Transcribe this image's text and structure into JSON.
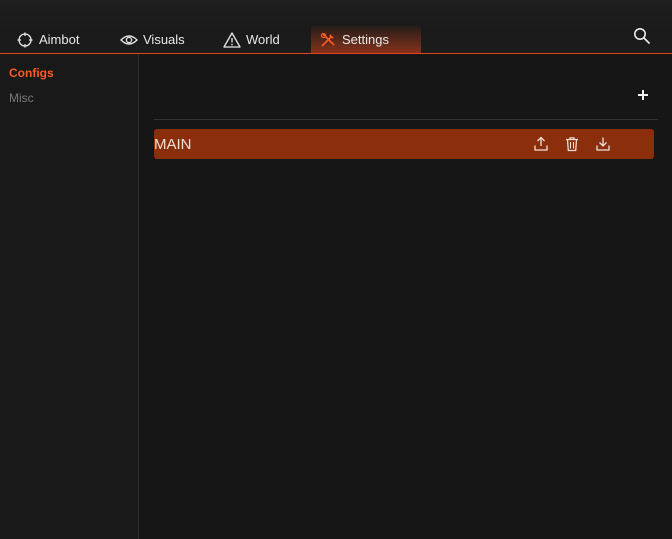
{
  "nav": {
    "tabs": [
      {
        "label": "Aimbot",
        "icon": "crosshair-icon",
        "active": false
      },
      {
        "label": "Visuals",
        "icon": "eye-icon",
        "active": false
      },
      {
        "label": "World",
        "icon": "warning-triangle-icon",
        "active": false
      },
      {
        "label": "Settings",
        "icon": "tools-icon",
        "active": true
      }
    ],
    "search_icon": "search-icon"
  },
  "sidebar": {
    "items": [
      {
        "label": "Configs",
        "active": true
      },
      {
        "label": "Misc",
        "active": false
      }
    ]
  },
  "configs": {
    "add_label": "+",
    "list": [
      {
        "name": "MAIN",
        "actions": [
          "upload-icon",
          "trash-icon",
          "download-icon"
        ]
      }
    ]
  },
  "colors": {
    "accent": "#ff5a1f",
    "row_background": "#8a2e0c",
    "background": "#161616"
  }
}
